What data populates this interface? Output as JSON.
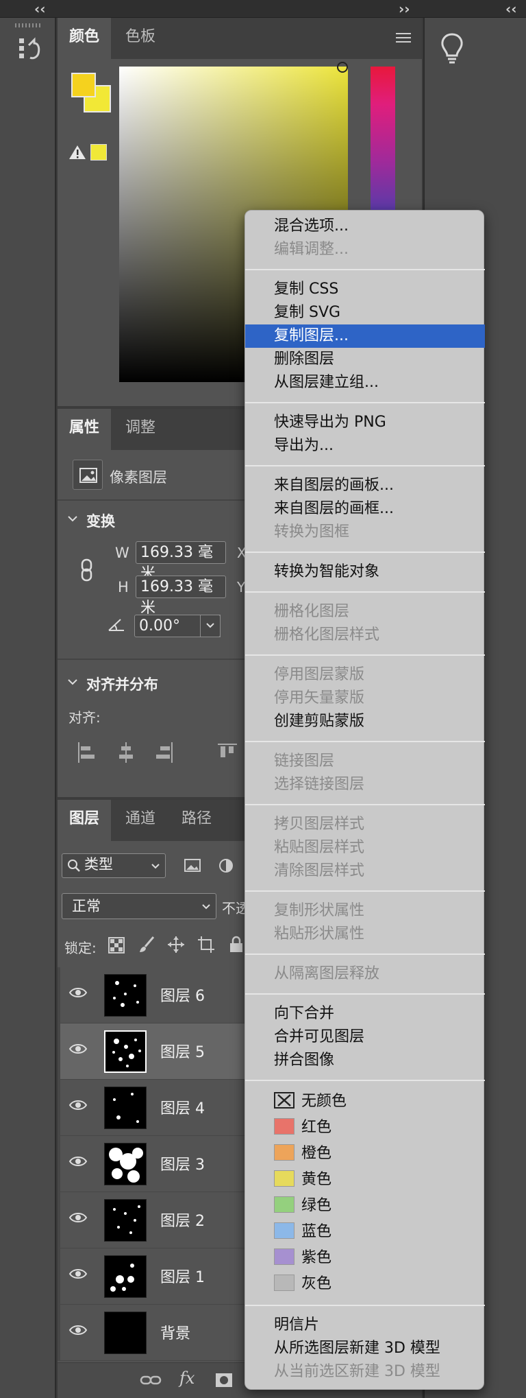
{
  "color_panel": {
    "tabs": [
      "颜色",
      "色板"
    ],
    "foreground_color": "#f5d21e",
    "background_color": "#f2e836"
  },
  "properties_panel": {
    "tabs": [
      "属性",
      "调整"
    ],
    "layer_type": "像素图层",
    "transform": {
      "title": "变换",
      "w_label": "W",
      "w_value": "169.33 毫米",
      "h_label": "H",
      "h_value": "169.33 毫米",
      "x_label": "X",
      "y_label": "Y",
      "angle_value": "0.00°"
    },
    "align": {
      "title": "对齐并分布",
      "label": "对齐:"
    }
  },
  "layers_panel": {
    "tabs": [
      "图层",
      "通道",
      "路径"
    ],
    "filter_label": "类型",
    "blend_mode": "正常",
    "opacity_label": "不透",
    "lock_label": "锁定:",
    "layers": [
      {
        "name": "图层 6",
        "selected": false
      },
      {
        "name": "图层 5",
        "selected": true
      },
      {
        "name": "图层 4",
        "selected": false
      },
      {
        "name": "图层 3",
        "selected": false
      },
      {
        "name": "图层 2",
        "selected": false
      },
      {
        "name": "图层 1",
        "selected": false
      },
      {
        "name": "背景",
        "selected": false
      }
    ],
    "footer_icons": [
      "link-icon",
      "fx-icon",
      "mask-icon"
    ],
    "fx_label": "fx"
  },
  "context_menu": {
    "items": [
      {
        "label": "混合选项...",
        "disabled": false
      },
      {
        "label": "编辑调整...",
        "disabled": true
      },
      {
        "sep": true
      },
      {
        "label": "复制 CSS",
        "disabled": false
      },
      {
        "label": "复制 SVG",
        "disabled": false
      },
      {
        "label": "复制图层...",
        "disabled": false,
        "highlighted": true
      },
      {
        "label": "删除图层",
        "disabled": false
      },
      {
        "label": "从图层建立组...",
        "disabled": false
      },
      {
        "sep": true
      },
      {
        "label": "快速导出为 PNG",
        "disabled": false
      },
      {
        "label": "导出为...",
        "disabled": false
      },
      {
        "sep": true
      },
      {
        "label": "来自图层的画板...",
        "disabled": false
      },
      {
        "label": "来自图层的画框...",
        "disabled": false
      },
      {
        "label": "转换为图框",
        "disabled": true
      },
      {
        "sep": true
      },
      {
        "label": "转换为智能对象",
        "disabled": false
      },
      {
        "sep": true
      },
      {
        "label": "栅格化图层",
        "disabled": true
      },
      {
        "label": "栅格化图层样式",
        "disabled": true
      },
      {
        "sep": true
      },
      {
        "label": "停用图层蒙版",
        "disabled": true
      },
      {
        "label": "停用矢量蒙版",
        "disabled": true
      },
      {
        "label": "创建剪贴蒙版",
        "disabled": false
      },
      {
        "sep": true
      },
      {
        "label": "链接图层",
        "disabled": true
      },
      {
        "label": "选择链接图层",
        "disabled": true
      },
      {
        "sep": true
      },
      {
        "label": "拷贝图层样式",
        "disabled": true
      },
      {
        "label": "粘贴图层样式",
        "disabled": true
      },
      {
        "label": "清除图层样式",
        "disabled": true
      },
      {
        "sep": true
      },
      {
        "label": "复制形状属性",
        "disabled": true
      },
      {
        "label": "粘贴形状属性",
        "disabled": true
      },
      {
        "sep": true
      },
      {
        "label": "从隔离图层释放",
        "disabled": true
      },
      {
        "sep": true
      },
      {
        "label": "向下合并",
        "disabled": false
      },
      {
        "label": "合并可见图层",
        "disabled": false
      },
      {
        "label": "拼合图像",
        "disabled": false
      },
      {
        "sep": true
      },
      {
        "label": "无颜色",
        "swatch": "none",
        "disabled": false
      },
      {
        "label": "红色",
        "swatch": "#e8736a",
        "disabled": false
      },
      {
        "label": "橙色",
        "swatch": "#eda45a",
        "disabled": false
      },
      {
        "label": "黄色",
        "swatch": "#e6da5c",
        "disabled": false
      },
      {
        "label": "绿色",
        "swatch": "#94d07e",
        "disabled": false
      },
      {
        "label": "蓝色",
        "swatch": "#8cb8e8",
        "disabled": false
      },
      {
        "label": "紫色",
        "swatch": "#a690d0",
        "disabled": false
      },
      {
        "label": "灰色",
        "swatch": "#b8b8b8",
        "disabled": false
      },
      {
        "sep": true
      },
      {
        "label": "明信片",
        "disabled": false
      },
      {
        "label": "从所选图层新建 3D 模型",
        "disabled": false
      },
      {
        "label": "从当前选区新建 3D 模型",
        "disabled": true
      }
    ]
  },
  "top_strip": {
    "collapse_left": "‹‹",
    "expand_mid": "››",
    "collapse_right": "‹‹"
  }
}
